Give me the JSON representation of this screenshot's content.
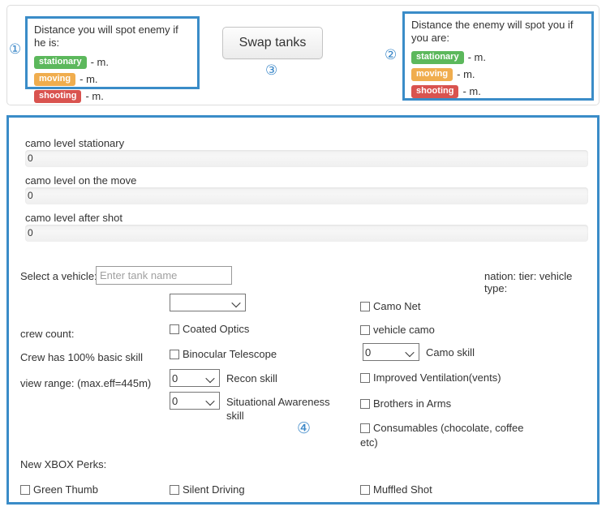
{
  "top_panel": {
    "left_box": {
      "marker": "①",
      "headline": "Distance you will spot enemy if he is:",
      "rows": [
        {
          "badge": "stationary",
          "value": "- m."
        },
        {
          "badge": "moving",
          "value": "- m."
        },
        {
          "badge": "shooting",
          "value": "- m."
        }
      ]
    },
    "right_box": {
      "marker": "②",
      "headline": "Distance the enemy will spot you if you are:",
      "rows": [
        {
          "badge": "stationary",
          "value": "- m."
        },
        {
          "badge": "moving",
          "value": "- m."
        },
        {
          "badge": "shooting",
          "value": "- m."
        }
      ]
    },
    "swap": {
      "label": "Swap tanks",
      "marker": "③"
    }
  },
  "main_panel": {
    "marker": "④",
    "camo_bars": [
      {
        "label": "camo level stationary",
        "value": "0"
      },
      {
        "label": "camo level on the move",
        "value": "0"
      },
      {
        "label": "camo level after shot",
        "value": "0"
      }
    ],
    "vehicle": {
      "select_label": "Select a vehicle:",
      "input_value": "",
      "input_placeholder": "Enter tank name",
      "info_label": "nation: tier: vehicle type:"
    },
    "left_labels": {
      "crew_count": "crew count:",
      "basic_skill": "Crew has 100% basic skill",
      "view_range": "view range: (max.eff=445m)"
    },
    "module_select": {
      "value": "",
      "options": [
        ""
      ]
    },
    "middle_checkboxes": [
      {
        "label": "Coated Optics",
        "checked": false
      },
      {
        "label": "Binocular Telescope",
        "checked": false
      }
    ],
    "skill_selects": [
      {
        "value": "0",
        "label": "Recon skill",
        "options": [
          "0"
        ]
      },
      {
        "value": "0",
        "label": "Situational Awareness skill",
        "options": [
          "0"
        ]
      }
    ],
    "right_column": {
      "checkbox_camo_net": {
        "label": "Camo Net",
        "checked": false
      },
      "checkbox_vehicle_camo": {
        "label": "vehicle camo",
        "checked": false
      },
      "camo_skill": {
        "value": "0",
        "label": "Camo skill",
        "options": [
          "0"
        ]
      },
      "checkbox_vents": {
        "label": "Improved Ventilation(vents)",
        "checked": false
      },
      "checkbox_bia": {
        "label": "Brothers in Arms",
        "checked": false
      },
      "checkbox_consumables": {
        "label": "Consumables (chocolate, coffee etc)",
        "checked": false
      }
    },
    "perks": {
      "title": "New XBOX Perks:",
      "items": [
        {
          "label": "Green Thumb",
          "checked": false
        },
        {
          "label": "Silent Driving",
          "checked": false
        },
        {
          "label": "Muffled Shot",
          "checked": false
        }
      ]
    }
  },
  "colors": {
    "accent_blue": "#3a8cc8",
    "badge_green": "#5cb85c",
    "badge_orange": "#f0ad4e",
    "badge_red": "#d9534f",
    "bar_gray": "#f2f2f2"
  }
}
